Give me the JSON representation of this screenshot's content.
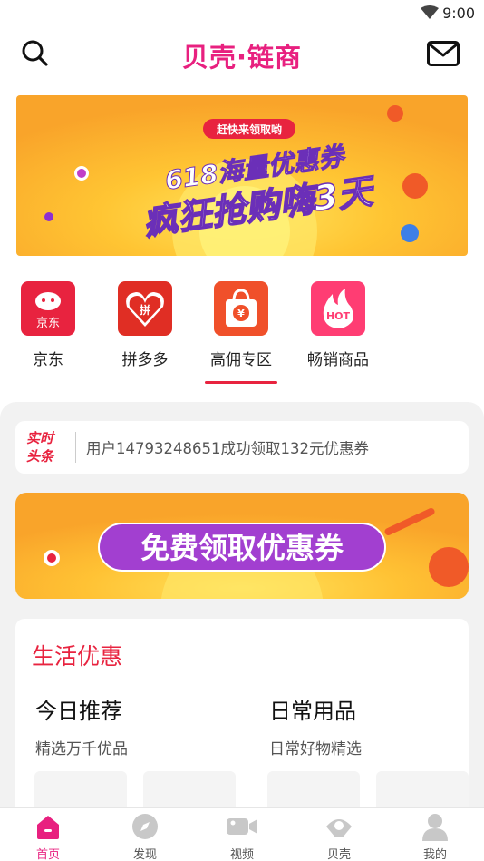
{
  "status_bar": {
    "time": "9:00"
  },
  "header": {
    "title": "贝壳·链商"
  },
  "banner": {
    "tag": "赶快来领取哟",
    "line1": "618海量优惠券",
    "line2": "疯狂抢购嗨3天"
  },
  "categories": [
    {
      "label": "京东",
      "icon": "jd-icon",
      "icon_text": "京东"
    },
    {
      "label": "拼多多",
      "icon": "pinduoduo-icon",
      "icon_text": "拼"
    },
    {
      "label": "高佣专区",
      "icon": "high-commission-bag-icon",
      "icon_text": "¥"
    },
    {
      "label": "畅销商品",
      "icon": "hot-icon",
      "icon_text": "HOT"
    }
  ],
  "news": {
    "badge_line1": "实时",
    "badge_line2": "头条",
    "text": "用户14793248651成功领取132元优惠券"
  },
  "promo": {
    "label": "免费领取优惠券"
  },
  "life": {
    "heading": "生活优惠",
    "cols": [
      {
        "title": "今日推荐",
        "subtitle": "精选万千优品"
      },
      {
        "title": "日常用品",
        "subtitle": "日常好物精选"
      }
    ]
  },
  "tabs": [
    {
      "label": "首页",
      "icon": "home-icon",
      "active": true
    },
    {
      "label": "发现",
      "icon": "compass-icon",
      "active": false
    },
    {
      "label": "视频",
      "icon": "video-camera-icon",
      "active": false
    },
    {
      "label": "贝壳",
      "icon": "shell-icon",
      "active": false
    },
    {
      "label": "我的",
      "icon": "profile-icon",
      "active": false
    }
  ],
  "colors": {
    "brand": "#e8207f",
    "accent_red": "#e8233f",
    "banner_orange": "#f9a42a"
  }
}
